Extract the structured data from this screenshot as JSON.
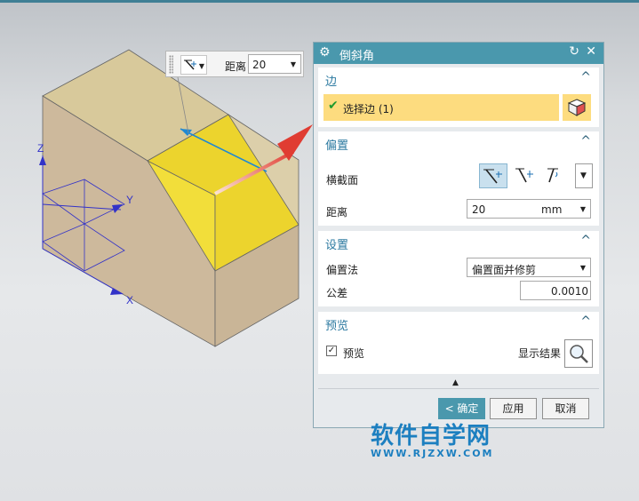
{
  "colors": {
    "accent": "#4a98ad",
    "section_title": "#2b79a0",
    "selection_highlight": "#fddc7f",
    "annotation_arrow": "#e03c32",
    "watermark": "#1c7fc0"
  },
  "mini_toolbar": {
    "icon": "cross-section-icon",
    "distance_label": "距离",
    "distance_value": "20"
  },
  "axes": {
    "z": "Z",
    "y": "Y",
    "x": "X"
  },
  "dialog": {
    "title": "倒斜角",
    "icons": {
      "settings": "gear-icon",
      "reset": "reset-icon",
      "close": "close-icon"
    },
    "edge": {
      "title": "边",
      "select_text": "选择边 (1)",
      "select_icon": "cube-icon"
    },
    "offsets": {
      "title": "偏置",
      "cross_section_label": "横截面",
      "distance_label": "距离",
      "distance_value": "20",
      "distance_unit": "mm"
    },
    "settings": {
      "title": "设置",
      "method_label": "偏置法",
      "method_value": "偏置面并修剪",
      "tolerance_label": "公差",
      "tolerance_value": "0.0010"
    },
    "preview": {
      "title": "预览",
      "checkbox_label": "预览",
      "checked": true,
      "show_result_label": "显示结果"
    },
    "buttons": {
      "ok": "< 确定 >",
      "apply": "应用",
      "cancel": "取消"
    }
  },
  "watermark": {
    "line1": "软件自学网",
    "line2": "WWW.RJZXW.COM"
  }
}
